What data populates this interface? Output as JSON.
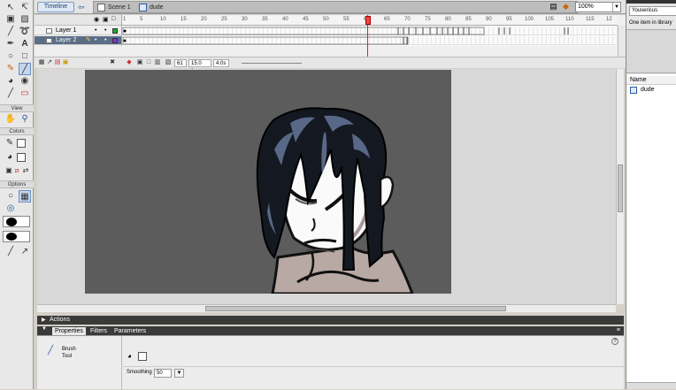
{
  "editbar": {
    "timeline_label": "Timeline",
    "scene_label": "Scene 1",
    "symbol_label": "dude",
    "zoom_value": "100%"
  },
  "tools": {
    "view_label": "View",
    "colors_label": "Colors",
    "options_label": "Options",
    "selected_tool": "brush-tool"
  },
  "timeline": {
    "layers": [
      {
        "name": "Layer 1",
        "color": "#22aa22",
        "selected": false
      },
      {
        "name": "Layer 2",
        "color": "#8a2be2",
        "selected": true
      }
    ],
    "frame_ticks": [
      "1",
      "5",
      "10",
      "15",
      "20",
      "25",
      "30",
      "35",
      "40",
      "45",
      "50",
      "55",
      "60",
      "65",
      "70",
      "75",
      "80",
      "85",
      "90",
      "95",
      "100",
      "105",
      "110",
      "115",
      "12"
    ],
    "current_frame": "61",
    "fps": "15.0 fps",
    "elapsed": "4.0s"
  },
  "panels": {
    "actions_label": "Actions",
    "tabs": [
      {
        "label": "Properties",
        "active": true
      },
      {
        "label": "Filters",
        "active": false
      },
      {
        "label": "Parameters",
        "active": false
      }
    ],
    "tool_name_line1": "Brush",
    "tool_name_line2": "Tool",
    "smoothing_label": "Smoothing",
    "smoothing_value": "50"
  },
  "library": {
    "document": "Yousericus",
    "count_text": "One item in library",
    "name_header": "Name",
    "items": [
      {
        "name": "dude",
        "type": "movie-clip"
      }
    ]
  },
  "colors": {
    "canvas_bg": "#5c5c5c",
    "stage_bg": "#d8d8d8",
    "accent": "#2d5aa0"
  }
}
